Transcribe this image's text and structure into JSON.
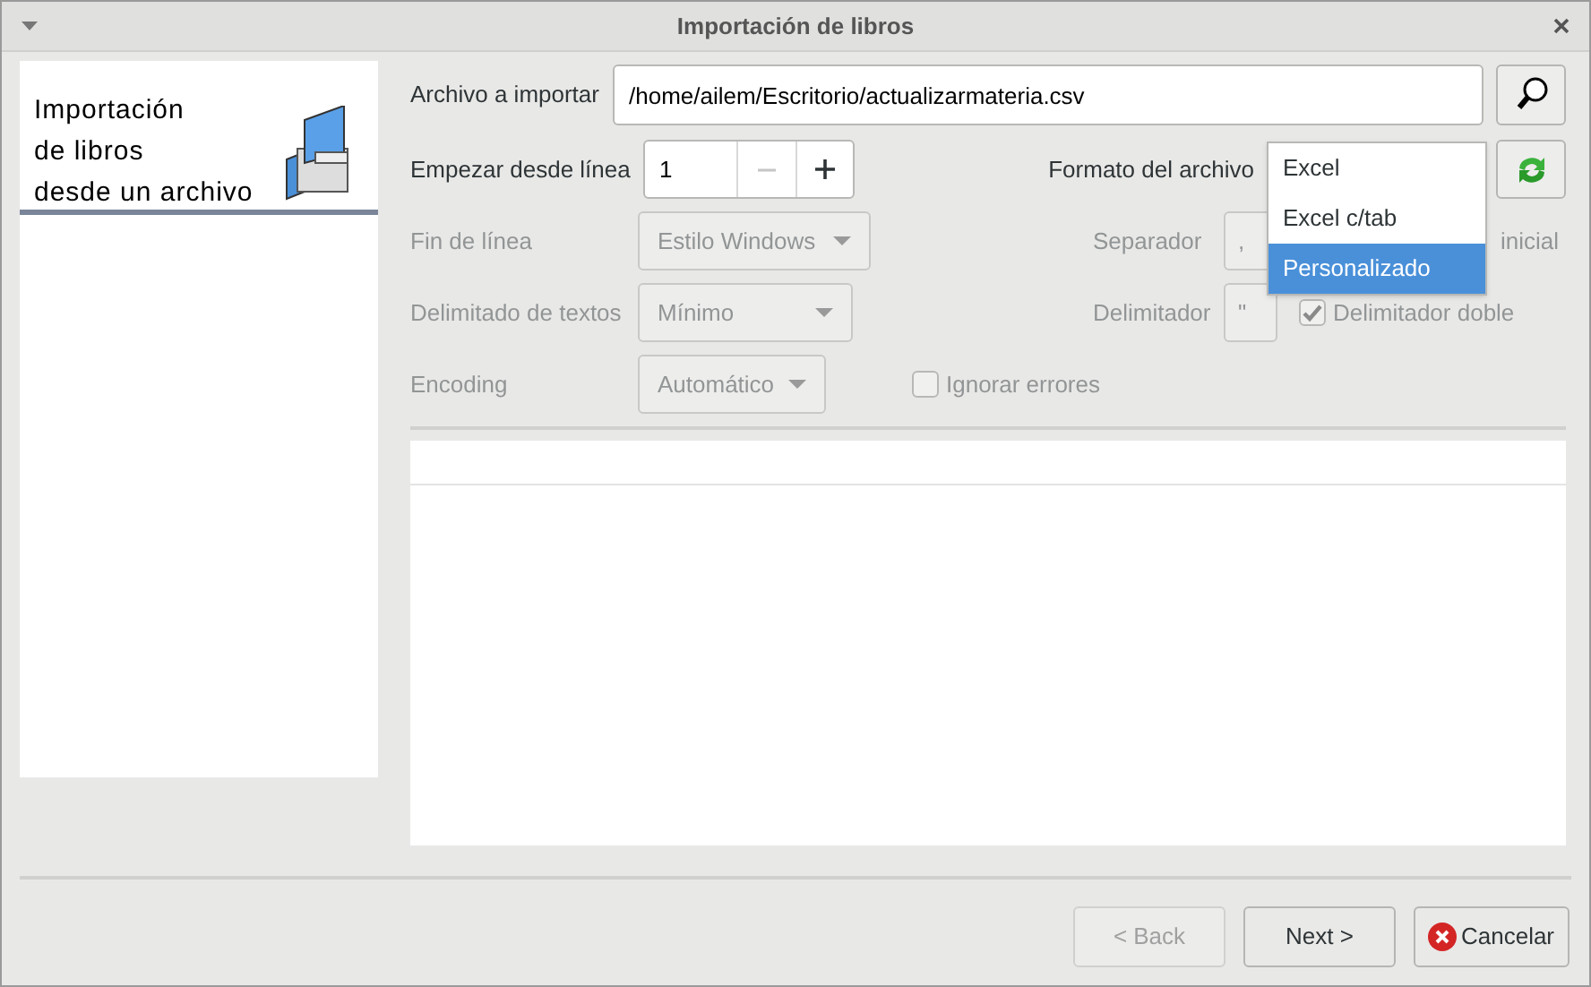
{
  "window": {
    "title": "Importación de libros"
  },
  "banner": {
    "lines": [
      "Importación",
      "de libros",
      "desde un archivo"
    ]
  },
  "file": {
    "label": "Archivo a importar",
    "value": "/home/ailem/Escritorio/actualizarmateria.csv"
  },
  "start_line": {
    "label": "Empezar desde línea",
    "value": "1",
    "decrement_disabled": true
  },
  "format": {
    "label": "Formato del archivo",
    "options": [
      {
        "label": "Excel",
        "selected": false
      },
      {
        "label": "Excel c/tab",
        "selected": false
      },
      {
        "label": "Personalizado",
        "selected": true
      }
    ]
  },
  "option_rows": [
    {
      "label": "Fin de línea",
      "combo": "Estilo Windows",
      "disabled": true,
      "right_label": "Separador",
      "right_value": ",",
      "trailing_text": "inicial"
    },
    {
      "label": "Delimitado de textos",
      "combo": "Mínimo",
      "disabled": true,
      "right_label": "Delimitador",
      "right_value": "\"",
      "check": {
        "label": "Delimitador doble",
        "checked": true
      }
    },
    {
      "label": "Encoding",
      "combo": "Automático",
      "disabled": true,
      "check": {
        "label": "Ignorar errores",
        "checked": false
      }
    }
  ],
  "buttons": [
    {
      "label": "< Back",
      "disabled": true,
      "kind": "plain"
    },
    {
      "label": "Next >",
      "disabled": false,
      "kind": "plain"
    },
    {
      "label": "Cancelar",
      "disabled": false,
      "kind": "cancel"
    }
  ]
}
